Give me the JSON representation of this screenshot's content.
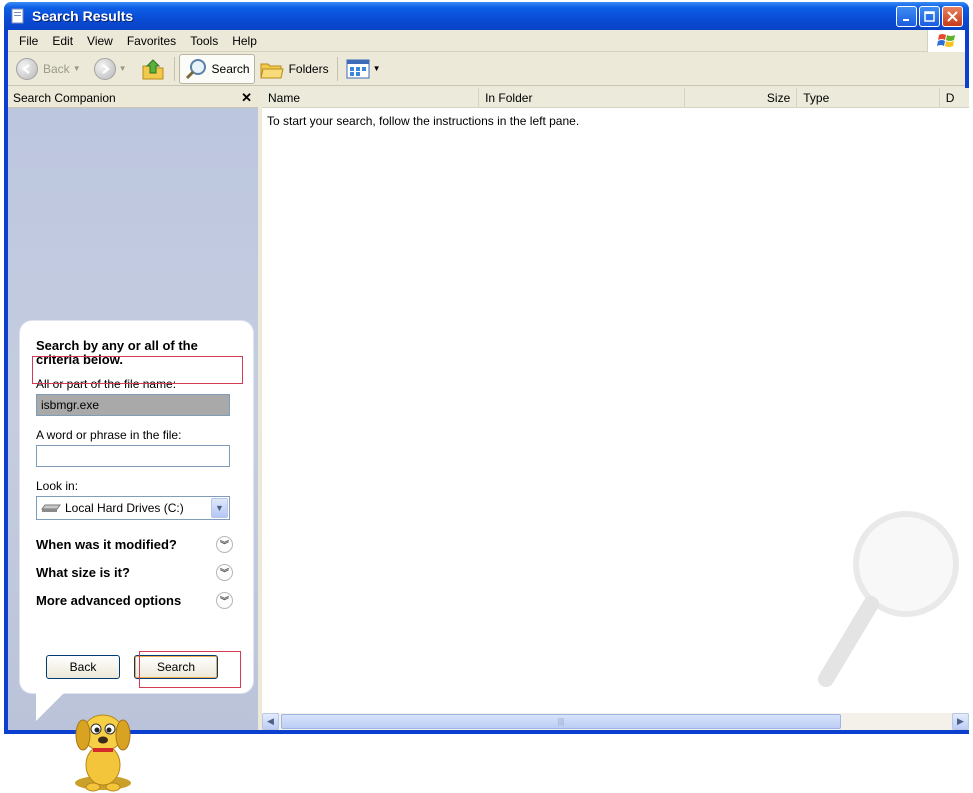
{
  "window": {
    "title": "Search Results"
  },
  "menu": {
    "items": [
      "File",
      "Edit",
      "View",
      "Favorites",
      "Tools",
      "Help"
    ]
  },
  "toolbar": {
    "back_label": "Back",
    "search_label": "Search",
    "folders_label": "Folders"
  },
  "search_companion": {
    "header_title": "Search Companion",
    "heading": "Search by any or all of the criteria below.",
    "filename_label": "All or part of the file name:",
    "filename_value": "isbmgr.exe",
    "phrase_label": "A word or phrase in the file:",
    "phrase_value": "",
    "look_in_label": "Look in:",
    "look_in_value": "Local Hard Drives (C:)",
    "options": [
      "When was it modified?",
      "What size is it?",
      "More advanced options"
    ],
    "back_button": "Back",
    "search_button": "Search"
  },
  "results": {
    "columns": [
      "Name",
      "In Folder",
      "Size",
      "Type",
      "D"
    ],
    "message": "To start your search, follow the instructions in the left pane."
  },
  "colors": {
    "titlebar": "#0a4cd6",
    "highlight_box": "#d33a53",
    "pane_background": "#bfc8e0"
  }
}
